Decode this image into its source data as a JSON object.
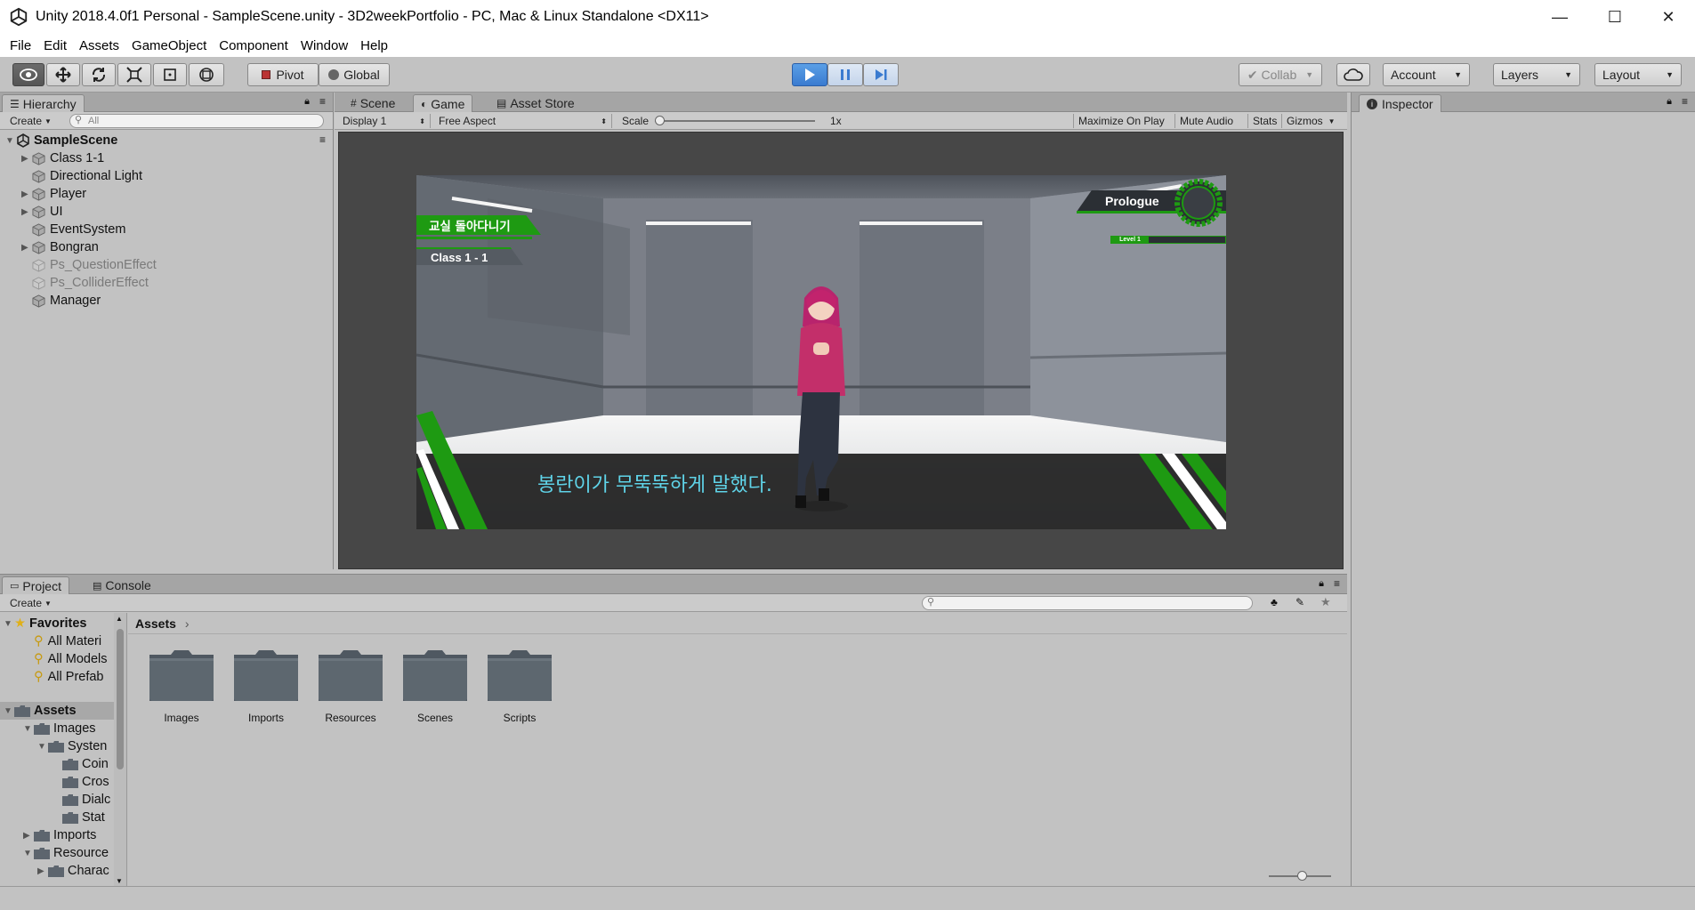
{
  "window": {
    "title": "Unity 2018.4.0f1 Personal - SampleScene.unity - 3D2weekPortfolio - PC, Mac & Linux Standalone <DX11>",
    "minimize": "—",
    "maximize": "☐",
    "close": "✕"
  },
  "menu": [
    "File",
    "Edit",
    "Assets",
    "GameObject",
    "Component",
    "Window",
    "Help"
  ],
  "toolbar": {
    "pivot": "Pivot",
    "global": "Global",
    "collab": "Collab",
    "account": "Account",
    "layers": "Layers",
    "layout": "Layout",
    "play_state": "playing"
  },
  "hierarchy": {
    "tab": "Hierarchy",
    "create": "Create",
    "search_placeholder": "All",
    "scene": "SampleScene",
    "items": [
      {
        "label": "Class 1-1",
        "expandable": true,
        "dim": false
      },
      {
        "label": "Directional Light",
        "expandable": false,
        "dim": false
      },
      {
        "label": "Player",
        "expandable": true,
        "dim": false
      },
      {
        "label": "UI",
        "expandable": true,
        "dim": false
      },
      {
        "label": "EventSystem",
        "expandable": false,
        "dim": false
      },
      {
        "label": "Bongran",
        "expandable": true,
        "dim": false
      },
      {
        "label": "Ps_QuestionEffect",
        "expandable": false,
        "dim": true
      },
      {
        "label": "Ps_ColliderEffect",
        "expandable": false,
        "dim": true
      },
      {
        "label": "Manager",
        "expandable": false,
        "dim": false
      }
    ]
  },
  "game_view": {
    "tabs": [
      "Scene",
      "Game",
      "Asset Store"
    ],
    "display": "Display 1",
    "aspect": "Free Aspect",
    "scale_label": "Scale",
    "scale_value": "1x",
    "maximize_on_play": "Maximize On Play",
    "mute_audio": "Mute Audio",
    "stats": "Stats",
    "gizmos": "Gizmos",
    "hud_quest": "교실 돌아다니기",
    "hud_location": "Class 1 - 1",
    "hud_chapter": "Prologue",
    "hud_level": "Level 1",
    "dialogue": "봉란이가 무뚝뚝하게 말했다."
  },
  "inspector": {
    "tab": "Inspector"
  },
  "project": {
    "tabs": [
      "Project",
      "Console"
    ],
    "create": "Create",
    "breadcrumb": "Assets",
    "favorites_label": "Favorites",
    "favorites": [
      "All Materi",
      "All Models",
      "All Prefab"
    ],
    "assets_label": "Assets",
    "tree": [
      {
        "label": "Images",
        "indent": 1,
        "arrow": "▼"
      },
      {
        "label": "Systen",
        "indent": 2,
        "arrow": "▼"
      },
      {
        "label": "Coin",
        "indent": 3,
        "arrow": ""
      },
      {
        "label": "Cros",
        "indent": 3,
        "arrow": ""
      },
      {
        "label": "Dialc",
        "indent": 3,
        "arrow": ""
      },
      {
        "label": "Stat",
        "indent": 3,
        "arrow": ""
      },
      {
        "label": "Imports",
        "indent": 1,
        "arrow": "▶"
      },
      {
        "label": "Resource",
        "indent": 1,
        "arrow": "▼"
      },
      {
        "label": "Charac",
        "indent": 2,
        "arrow": "▶"
      }
    ],
    "folders": [
      "Images",
      "Imports",
      "Resources",
      "Scenes",
      "Scripts"
    ]
  },
  "colors": {
    "play_blue": "#3a7bd0",
    "hud_green": "#1e9a12",
    "dialogue_text": "#5fd3e8"
  }
}
